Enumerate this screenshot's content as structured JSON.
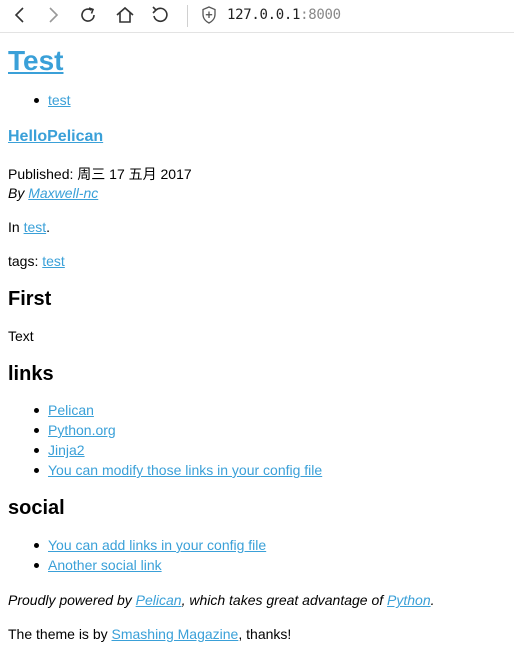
{
  "browser": {
    "address_host": "127.0.0.1",
    "address_port": ":8000",
    "icons": [
      "back-icon",
      "forward-icon",
      "reload-icon",
      "home-icon",
      "undo-icon",
      "shield-icon"
    ]
  },
  "page": {
    "site_title": "Test",
    "menu_items": [
      "test"
    ],
    "article_title": "HelloPelican",
    "published_label": "Published: ",
    "published_date": "周三 17 五月 2017",
    "by_label": "By ",
    "author": "Maxwell-nc",
    "in_label": "In ",
    "category": "test",
    "period": ".",
    "tags_label": "tags: ",
    "tag": "test",
    "content_heading": "First",
    "content_text": "Text",
    "links_heading": "links",
    "links": [
      "Pelican",
      "Python.org",
      "Jinja2",
      "You can modify those links in your config file"
    ],
    "social_heading": "social",
    "social": [
      "You can add links in your config file",
      "Another social link"
    ],
    "footer1": {
      "prefix": "Proudly powered by ",
      "pelican": "Pelican",
      "middle": ", which takes great advantage of ",
      "python": "Python",
      "suffix": "."
    },
    "footer2": {
      "prefix": "The theme is by ",
      "link": "Smashing Magazine",
      "suffix": ", thanks!"
    }
  }
}
